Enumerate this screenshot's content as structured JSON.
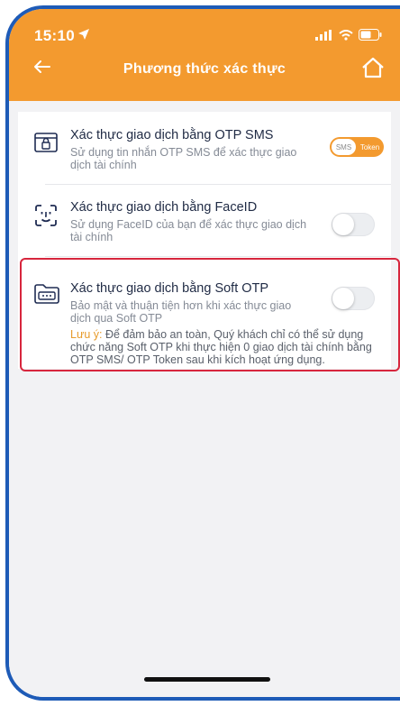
{
  "status_bar": {
    "time": "15:10"
  },
  "header": {
    "title": "Phương thức xác thực"
  },
  "items": [
    {
      "title": "Xác thực giao dịch bằng OTP SMS",
      "description": "Sử dụng tin nhắn OTP SMS để xác thực giao dịch tài chính",
      "toggle_left": "SMS",
      "toggle_right": "Token"
    },
    {
      "title": "Xác thực giao dịch bằng FaceID",
      "description": "Sử dụng FaceID của bạn để xác thực giao dịch tài chính",
      "enabled": false
    },
    {
      "title": "Xác thực giao dịch bằng Soft OTP",
      "description": "Bảo mật và thuận tiện hơn khi xác thực giao dịch qua Soft OTP",
      "note_label": "Lưu ý:",
      "note": " Để đảm bảo an toàn, Quý khách chỉ có thể sử dụng chức năng Soft OTP khi thực hiện 0 giao dịch tài chính bằng OTP SMS/ OTP Token sau khi kích hoạt ứng dụng.",
      "enabled": false
    }
  ],
  "colors": {
    "accent": "#f39a2f",
    "highlight": "#d7263d",
    "frame": "#1e5bb7"
  }
}
